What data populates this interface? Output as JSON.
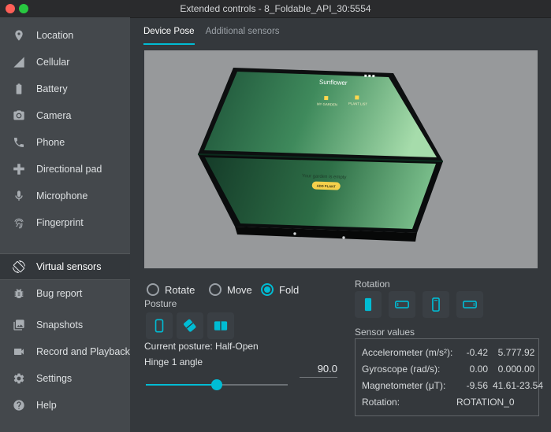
{
  "theme": {
    "accent": "#00bcd4",
    "sidebar_bg": "#44484c",
    "main_bg": "#34383c",
    "viewport_bg": "#97999b",
    "screen_green_light": "#a6dcab",
    "screen_green_dark": "#1d5238",
    "mini_button_yellow": "#f6d04b"
  },
  "window": {
    "title": "Extended controls - 8_Foldable_API_30:5554"
  },
  "sidebar": {
    "items": [
      {
        "label": "Location"
      },
      {
        "label": "Cellular"
      },
      {
        "label": "Battery"
      },
      {
        "label": "Camera"
      },
      {
        "label": "Phone"
      },
      {
        "label": "Directional pad"
      },
      {
        "label": "Microphone"
      },
      {
        "label": "Fingerprint"
      },
      {
        "label": "Virtual sensors",
        "selected": true
      },
      {
        "label": "Bug report"
      },
      {
        "label": "Snapshots"
      },
      {
        "label": "Record and Playback"
      },
      {
        "label": "Settings"
      },
      {
        "label": "Help"
      }
    ]
  },
  "tabs": [
    {
      "label": "Device Pose",
      "active": true
    },
    {
      "label": "Additional sensors",
      "active": false
    }
  ],
  "device_preview": {
    "app_title": "Sunflower",
    "nav_tabs": [
      "MY GARDEN",
      "PLANT LIST"
    ],
    "empty_message": "Your garden is empty",
    "add_plant_button": "ADD PLANT"
  },
  "pose_controls": {
    "modes": [
      {
        "label": "Rotate",
        "selected": false
      },
      {
        "label": "Move",
        "selected": false
      },
      {
        "label": "Fold",
        "selected": true
      }
    ],
    "posture_label": "Posture",
    "current_posture": "Current posture: Half-Open",
    "hinge_label": "Hinge 1 angle",
    "hinge_angle": "90.0"
  },
  "rotation": {
    "label": "Rotation"
  },
  "sensor_values": {
    "label": "Sensor values",
    "rows": [
      {
        "name": "Accelerometer (m/s²):",
        "v1": "-0.42",
        "v2": "5.77",
        "v3": "7.92"
      },
      {
        "name": "Gyroscope (rad/s):",
        "v1": "0.00",
        "v2": "0.00",
        "v3": "0.00"
      },
      {
        "name": "Magnetometer (μT):",
        "v1": "-9.56",
        "v2": "41.61",
        "v3": "-23.54"
      },
      {
        "name": "Rotation:",
        "value": "ROTATION_0"
      }
    ]
  }
}
